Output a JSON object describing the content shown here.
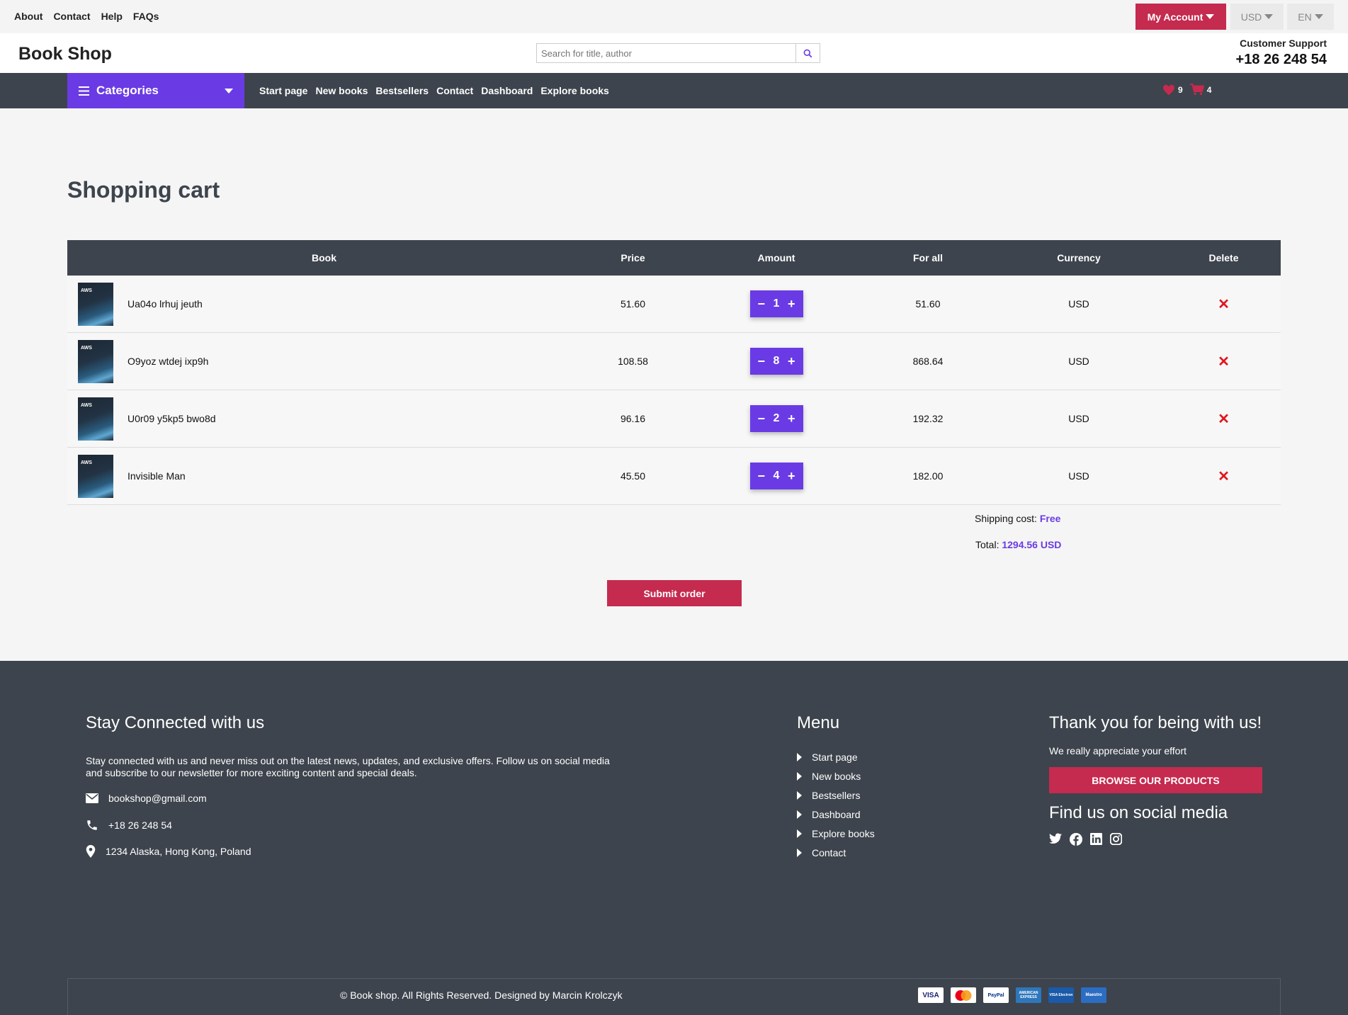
{
  "top_links": [
    "About",
    "Contact",
    "Help",
    "FAQs"
  ],
  "account": {
    "label": "My Account",
    "currency": "USD",
    "language": "EN"
  },
  "brand": "Book Shop",
  "search": {
    "placeholder": "Search for title, author",
    "value": ""
  },
  "support": {
    "label": "Customer Support",
    "phone": "+18 26 248 54"
  },
  "nav": {
    "categories_label": "Categories",
    "links": [
      "Start page",
      "New books",
      "Bestsellers",
      "Contact",
      "Dashboard",
      "Explore books"
    ],
    "wishlist_count": "9",
    "cart_count": "4"
  },
  "page_title": "Shopping cart",
  "cart": {
    "headers": {
      "book": "Book",
      "price": "Price",
      "amount": "Amount",
      "for_all": "For all",
      "currency": "Currency",
      "delete": "Delete"
    },
    "rows": [
      {
        "title": "Ua04o lrhuj jeuth",
        "price": "51.60",
        "amount": "1",
        "for_all": "51.60",
        "currency": "USD",
        "cover_title": "AWS"
      },
      {
        "title": "O9yoz wtdej ixp9h",
        "price": "108.58",
        "amount": "8",
        "for_all": "868.64",
        "currency": "USD",
        "cover_title": "AWS"
      },
      {
        "title": "U0r09 y5kp5 bwo8d",
        "price": "96.16",
        "amount": "2",
        "for_all": "192.32",
        "currency": "USD",
        "cover_title": "AWS"
      },
      {
        "title": "Invisible Man",
        "price": "45.50",
        "amount": "4",
        "for_all": "182.00",
        "currency": "USD",
        "cover_title": "AWS"
      }
    ],
    "shipping_label": "Shipping cost:",
    "shipping_value": "Free",
    "total_label": "Total:",
    "total_value": "1294.56 USD",
    "submit_label": "Submit order"
  },
  "footer": {
    "connect_heading": "Stay Connected with us",
    "connect_text": "Stay connected with us and never miss out on the latest news, updates, and exclusive offers. Follow us on social media and subscribe to our newsletter for more exciting content and special deals.",
    "email": "bookshop@gmail.com",
    "phone": "+18 26 248 54",
    "address": "1234 Alaska, Hong Kong, Poland",
    "menu_heading": "Menu",
    "menu_items": [
      "Start page",
      "New books",
      "Bestsellers",
      "Dashboard",
      "Explore books",
      "Contact"
    ],
    "thanks_heading": "Thank you for being with us!",
    "thanks_text": "We really appreciate your effort",
    "browse_label": "BROWSE OUR PRODUCTS",
    "social_heading": "Find us on social media",
    "social_icons": [
      "twitter-icon",
      "facebook-icon",
      "linkedin-icon",
      "instagram-icon"
    ],
    "copyright": "© Book shop. All Rights Reserved. Designed by Marcin Krolczyk",
    "payment_cards": [
      "VISA",
      "MasterCard",
      "PayPal",
      "AMERICAN EXPRESS",
      "VISA Electron",
      "Maestro"
    ]
  },
  "colors": {
    "accent": "#6a3be4",
    "brand_red": "#c52a4f",
    "dark": "#3d444d",
    "delete_red": "#e0161c"
  }
}
